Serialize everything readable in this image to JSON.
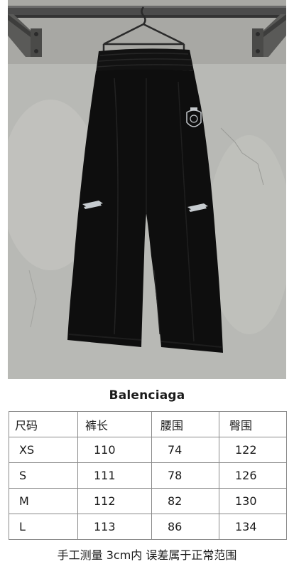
{
  "product": {
    "brand": "Balenciaga"
  },
  "size_table": {
    "headers": [
      "尺码",
      "裤长",
      "腰围",
      "臀围"
    ],
    "rows": [
      [
        "XS",
        "110",
        "74",
        "122"
      ],
      [
        "S",
        "111",
        "78",
        "126"
      ],
      [
        "M",
        "112",
        "82",
        "130"
      ],
      [
        "L",
        "113",
        "86",
        "134"
      ]
    ]
  },
  "footnote": "手工测量 3cm内 误差属于正常范围",
  "colors": {
    "wall": "#bcbcb8",
    "rail": "#4a4a4a",
    "garment": "#0e0e0e",
    "logo": "#bfc4c8"
  }
}
